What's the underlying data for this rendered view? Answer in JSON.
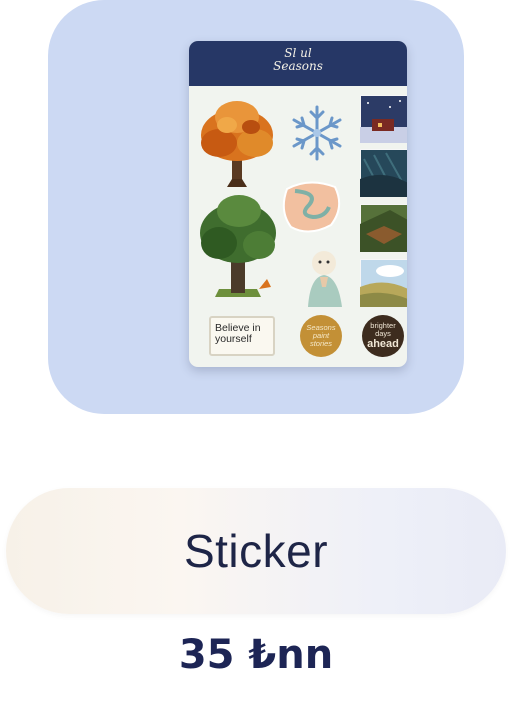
{
  "product": {
    "sheet": {
      "logo_top": "Sl ul",
      "logo_bottom": "Seasons",
      "label_sticker": "Believe in yourself",
      "badge_gold": [
        "Seasons",
        "paint",
        "stories"
      ],
      "badge_dark": [
        "brighter days",
        "ahead"
      ]
    },
    "title": "Sticker",
    "price": "35 ₺nn"
  },
  "colors": {
    "tile": "#ccd9f3",
    "header": "#263766",
    "title_text": "#1e2547",
    "price_text": "#1d2555"
  }
}
